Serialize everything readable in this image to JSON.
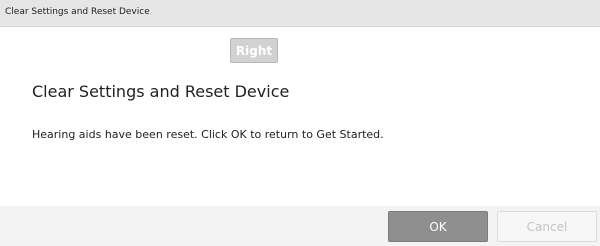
{
  "window": {
    "title": "Clear Settings and Reset Device"
  },
  "badge": {
    "side_label": "Right"
  },
  "content": {
    "heading": "Clear Settings and Reset Device",
    "message": "Hearing aids have been reset.  Click OK to return to Get Started."
  },
  "footer": {
    "ok_label": "OK",
    "cancel_label": "Cancel"
  },
  "colors": {
    "titlebar_bg": "#e6e6e6",
    "ok_button_bg": "#8f8f8f",
    "cancel_button_bg": "#f7f7f7",
    "badge_bg": "#d2d2d2"
  }
}
